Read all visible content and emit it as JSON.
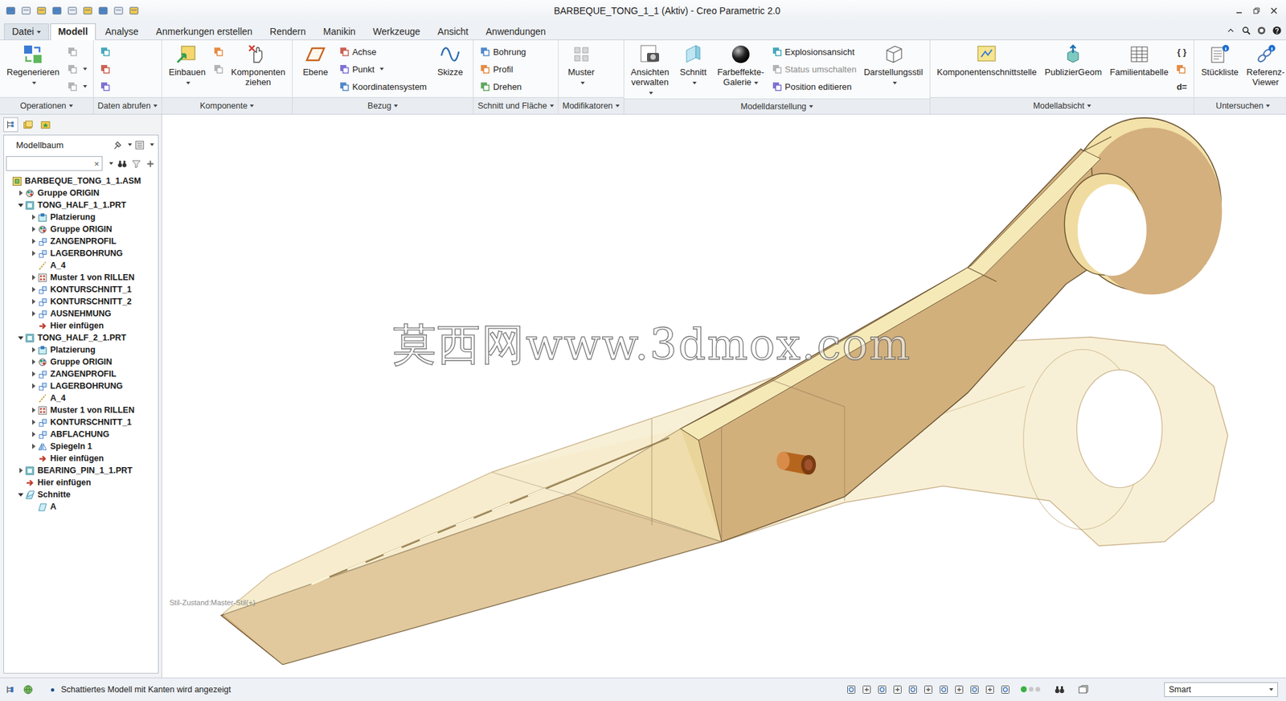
{
  "window": {
    "title": "BARBEQUE_TONG_1_1 (Aktiv) - Creo Parametric 2.0"
  },
  "tabs": [
    {
      "label": "Datei",
      "selected": false,
      "dropdown": true
    },
    {
      "label": "Modell",
      "selected": true,
      "dropdown": false
    },
    {
      "label": "Analyse",
      "selected": false,
      "dropdown": false
    },
    {
      "label": "Anmerkungen erstellen",
      "selected": false,
      "dropdown": false
    },
    {
      "label": "Rendern",
      "selected": false,
      "dropdown": false
    },
    {
      "label": "Manikin",
      "selected": false,
      "dropdown": false
    },
    {
      "label": "Werkzeuge",
      "selected": false,
      "dropdown": false
    },
    {
      "label": "Ansicht",
      "selected": false,
      "dropdown": false
    },
    {
      "label": "Anwendungen",
      "selected": false,
      "dropdown": false
    }
  ],
  "ribbon": [
    {
      "label": "Operationen",
      "dropdown": true,
      "items": [
        {
          "kind": "large",
          "label": "Regenerieren",
          "dropdown": true,
          "disabled": false
        },
        {
          "kind": "stack",
          "items": [
            {
              "kind": "icon",
              "dropdown": false,
              "disabled": true
            },
            {
              "kind": "icon",
              "dropdown": true,
              "disabled": true
            },
            {
              "kind": "icon",
              "dropdown": true,
              "disabled": true
            }
          ]
        }
      ]
    },
    {
      "label": "Daten abrufen",
      "dropdown": true,
      "items": [
        {
          "kind": "stack",
          "items": [
            {
              "kind": "icon",
              "dropdown": false,
              "disabled": false
            },
            {
              "kind": "icon",
              "dropdown": false,
              "disabled": false
            },
            {
              "kind": "icon",
              "dropdown": false,
              "disabled": false
            }
          ]
        }
      ]
    },
    {
      "label": "Komponente",
      "dropdown": true,
      "items": [
        {
          "kind": "large",
          "label": "Einbauen",
          "dropdown": true,
          "disabled": false
        },
        {
          "kind": "stack",
          "items": [
            {
              "kind": "icon",
              "dropdown": false,
              "disabled": false
            },
            {
              "kind": "icon",
              "dropdown": false,
              "disabled": true
            }
          ]
        },
        {
          "kind": "large",
          "label": "Komponenten ziehen",
          "dropdown": false,
          "disabled": false
        }
      ]
    },
    {
      "label": "Bezug",
      "dropdown": true,
      "items": [
        {
          "kind": "large",
          "label": "Ebene",
          "dropdown": false,
          "disabled": false
        },
        {
          "kind": "stack",
          "items": [
            {
              "kind": "small",
              "label": "Achse",
              "dropdown": false,
              "disabled": false
            },
            {
              "kind": "small",
              "label": "Punkt",
              "dropdown": true,
              "disabled": false
            },
            {
              "kind": "small",
              "label": "Koordinatensystem",
              "dropdown": false,
              "disabled": false
            }
          ]
        },
        {
          "kind": "large",
          "label": "Skizze",
          "dropdown": false,
          "disabled": false
        }
      ]
    },
    {
      "label": "Schnitt und Fläche",
      "dropdown": true,
      "items": [
        {
          "kind": "stack",
          "items": [
            {
              "kind": "small",
              "label": "Bohrung",
              "dropdown": false,
              "disabled": false
            },
            {
              "kind": "small",
              "label": "Profil",
              "dropdown": false,
              "disabled": false
            },
            {
              "kind": "small",
              "label": "Drehen",
              "dropdown": false,
              "disabled": false
            }
          ]
        }
      ]
    },
    {
      "label": "Modifikatoren",
      "dropdown": true,
      "items": [
        {
          "kind": "large",
          "label": "Muster",
          "dropdown": true,
          "disabled": false
        }
      ]
    },
    {
      "label": "Modelldarstellung",
      "dropdown": true,
      "items": [
        {
          "kind": "large",
          "label": "Ansichten verwalten",
          "dropdown": true,
          "disabled": false
        },
        {
          "kind": "large",
          "label": "Schnitt",
          "dropdown": true,
          "disabled": false
        },
        {
          "kind": "large",
          "label": "Farbeffekte-Galerie",
          "dropdown": true,
          "disabled": false
        },
        {
          "kind": "stack",
          "items": [
            {
              "kind": "small",
              "label": "Explosionsansicht",
              "dropdown": false,
              "disabled": false
            },
            {
              "kind": "small",
              "label": "Status umschalten",
              "dropdown": false,
              "disabled": true
            },
            {
              "kind": "small",
              "label": "Position editieren",
              "dropdown": false,
              "disabled": false
            }
          ]
        },
        {
          "kind": "large",
          "label": "Darstellungsstil",
          "dropdown": true,
          "disabled": false
        }
      ]
    },
    {
      "label": "Modellabsicht",
      "dropdown": true,
      "items": [
        {
          "kind": "large",
          "label": "Komponentenschnittstelle",
          "dropdown": false,
          "disabled": false
        },
        {
          "kind": "large",
          "label": "PublizierGeom",
          "dropdown": false,
          "disabled": false
        },
        {
          "kind": "large",
          "label": "Familientabelle",
          "dropdown": false,
          "disabled": false
        },
        {
          "kind": "stack",
          "items": [
            {
              "kind": "glyph",
              "glyph": "{ }",
              "dropdown": false,
              "disabled": false
            },
            {
              "kind": "icon",
              "dropdown": false,
              "disabled": false
            },
            {
              "kind": "glyph",
              "glyph": "d=",
              "dropdown": false,
              "disabled": false
            }
          ]
        }
      ]
    },
    {
      "label": "Untersuchen",
      "dropdown": true,
      "items": [
        {
          "kind": "large",
          "label": "Stückliste",
          "dropdown": false,
          "disabled": false
        },
        {
          "kind": "large",
          "label": "Referenz-Viewer",
          "dropdown": false,
          "disabled": false
        }
      ]
    }
  ],
  "model_tree": {
    "title": "Modellbaum",
    "search": {
      "value": "",
      "clear": "×"
    },
    "items": [
      {
        "level": 0,
        "label": "BARBEQUE_TONG_1_1.ASM",
        "kind": "assembly",
        "has_children": false,
        "expanded": false
      },
      {
        "level": 1,
        "label": "Gruppe ORIGIN",
        "kind": "group",
        "has_children": true,
        "expanded": false
      },
      {
        "level": 1,
        "label": "TONG_HALF_1_1.PRT",
        "kind": "part",
        "has_children": true,
        "expanded": true
      },
      {
        "level": 2,
        "label": "Platzierung",
        "kind": "placement",
        "has_children": true,
        "expanded": false
      },
      {
        "level": 2,
        "label": "Gruppe ORIGIN",
        "kind": "group",
        "has_children": true,
        "expanded": false
      },
      {
        "level": 2,
        "label": "ZANGENPROFIL",
        "kind": "feature",
        "has_children": true,
        "expanded": false
      },
      {
        "level": 2,
        "label": "LAGERBOHRUNG",
        "kind": "feature",
        "has_children": true,
        "expanded": false
      },
      {
        "level": 2,
        "label": "A_4",
        "kind": "axis",
        "has_children": false,
        "expanded": false
      },
      {
        "level": 2,
        "label": "Muster 1 von RILLEN",
        "kind": "pattern",
        "has_children": true,
        "expanded": false
      },
      {
        "level": 2,
        "label": "KONTURSCHNITT_1",
        "kind": "feature",
        "has_children": true,
        "expanded": false
      },
      {
        "level": 2,
        "label": "KONTURSCHNITT_2",
        "kind": "feature",
        "has_children": true,
        "expanded": false
      },
      {
        "level": 2,
        "label": "AUSNEHMUNG",
        "kind": "feature",
        "has_children": true,
        "expanded": false
      },
      {
        "level": 2,
        "label": "Hier einfügen",
        "kind": "insert",
        "has_children": false,
        "expanded": false
      },
      {
        "level": 1,
        "label": "TONG_HALF_2_1.PRT",
        "kind": "part",
        "has_children": true,
        "expanded": true
      },
      {
        "level": 2,
        "label": "Platzierung",
        "kind": "placement",
        "has_children": true,
        "expanded": false
      },
      {
        "level": 2,
        "label": "Gruppe ORIGIN",
        "kind": "group",
        "has_children": true,
        "expanded": false
      },
      {
        "level": 2,
        "label": "ZANGENPROFIL",
        "kind": "feature",
        "has_children": true,
        "expanded": false
      },
      {
        "level": 2,
        "label": "LAGERBOHRUNG",
        "kind": "feature",
        "has_children": true,
        "expanded": false
      },
      {
        "level": 2,
        "label": "A_4",
        "kind": "axis",
        "has_children": false,
        "expanded": false
      },
      {
        "level": 2,
        "label": "Muster 1 von RILLEN",
        "kind": "pattern",
        "has_children": true,
        "expanded": false
      },
      {
        "level": 2,
        "label": "KONTURSCHNITT_1",
        "kind": "feature",
        "has_children": true,
        "expanded": false
      },
      {
        "level": 2,
        "label": "ABFLACHUNG",
        "kind": "feature",
        "has_children": true,
        "expanded": false
      },
      {
        "level": 2,
        "label": "Spiegeln 1",
        "kind": "mirror",
        "has_children": true,
        "expanded": false
      },
      {
        "level": 2,
        "label": "Hier einfügen",
        "kind": "insert",
        "has_children": false,
        "expanded": false
      },
      {
        "level": 1,
        "label": "BEARING_PIN_1_1.PRT",
        "kind": "part",
        "has_children": true,
        "expanded": false
      },
      {
        "level": 1,
        "label": "Hier einfügen",
        "kind": "insert",
        "has_children": false,
        "expanded": false
      },
      {
        "level": 1,
        "label": "Schnitte",
        "kind": "sections",
        "has_children": true,
        "expanded": true
      },
      {
        "level": 2,
        "label": "A",
        "kind": "section",
        "has_children": false,
        "expanded": false
      }
    ]
  },
  "viewport": {
    "watermark": "莫西网www.3dmox.com",
    "style_state": "Stil-Zustand:Master-Stil(+)"
  },
  "status_bar": {
    "message": "Schattiertes Modell mit Kanten wird angezeigt",
    "filter": "Smart"
  }
}
